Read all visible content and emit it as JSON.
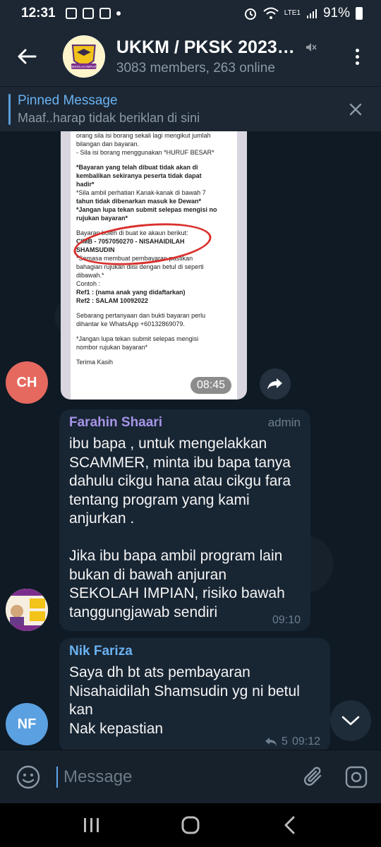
{
  "status_bar": {
    "time": "12:31",
    "battery": "91%",
    "network": "LTE1"
  },
  "header": {
    "title": "UKKM / PKSK 2023 -…",
    "subtitle": "3083 members, 263 online",
    "avatar_text": "SEKOLAH IMPIAN"
  },
  "pinned": {
    "title": "Pinned Message",
    "message": "Maaf..harap tidak beriklan di sini"
  },
  "photo_message": {
    "time": "08:45",
    "sender_initials": "CH",
    "lines": [
      {
        "t": "orang sila isi borang sekali lagi mengikut jumlah",
        "b": false
      },
      {
        "t": "bilangan dan bayaran.",
        "b": false
      },
      {
        "t": "- Sila isi borang menggunakan *HURUF BESAR*",
        "b": false
      },
      {
        "t": "",
        "b": false
      },
      {
        "t": "*Bayaran yang telah dibuat tidak akan di",
        "b": true
      },
      {
        "t": "kembalikan sekiranya peserta tidak dapat",
        "b": true
      },
      {
        "t": "hadir*",
        "b": true
      },
      {
        "t": "*Sila ambil perhatian Kanak-kanak di bawah 7",
        "b": false
      },
      {
        "t": "tahun tidak dibenarkan masuk ke Dewan*",
        "b": true
      },
      {
        "t": "*Jangan lupa tekan submit selepas mengisi no",
        "b": true
      },
      {
        "t": "rujukan bayaran*",
        "b": true
      },
      {
        "t": "",
        "b": false
      },
      {
        "t": "Bayaran boleh di buat ke akaun berikut:",
        "b": false
      },
      {
        "t": "CIMB - 7057050270 - NISAHAIDILAH",
        "b": true
      },
      {
        "t": "SHAMSUDIN",
        "b": true
      },
      {
        "t": "*Semasa membuat pembayaran pastikan",
        "b": false
      },
      {
        "t": "bahagian rujukan diisi dengan betul di seperti",
        "b": false
      },
      {
        "t": "dibawah.*",
        "b": false
      },
      {
        "t": "Contoh :",
        "b": false
      },
      {
        "t": "Ref1 : (nama anak yang didaftarkan)",
        "b": true
      },
      {
        "t": "Ref2 : SALAM 10092022",
        "b": true
      },
      {
        "t": "",
        "b": false
      },
      {
        "t": "Sebarang pertanyaan dan bukti bayaran perlu",
        "b": false
      },
      {
        "t": "dihantar ke WhatsApp +60132869079.",
        "b": false
      },
      {
        "t": "",
        "b": false
      },
      {
        "t": "*Jangan lupa tekan submit selepas mengisi",
        "b": false
      },
      {
        "t": "nombor rujukan bayaran*",
        "b": false
      },
      {
        "t": "",
        "b": false
      },
      {
        "t": "Terima Kasih",
        "b": false
      }
    ]
  },
  "messages": [
    {
      "sender": "Farahin Shaari",
      "sender_color": "#a695e7",
      "badge": "admin",
      "text": "ibu bapa , untuk mengelakkan SCAMMER, minta ibu bapa tanya dahulu cikgu hana atau cikgu fara tentang program yang kami anjurkan .\n\nJika ibu bapa ambil program lain bukan di bawah anjuran SEKOLAH IMPIAN, risiko bawah tanggungjawab sendiri",
      "time": "09:10"
    },
    {
      "sender": "Nik Fariza",
      "sender_color": "#6ab2f2",
      "sender_initials": "NF",
      "text": "Saya dh bt ats pembayaran Nisahaidilah Shamsudin yg ni betul kan\nNak kepastian",
      "replies": "5",
      "time": "09:12"
    }
  ],
  "input": {
    "placeholder": "Message"
  },
  "colors": {
    "bg": "#0e1621",
    "bubble": "#182533",
    "accent": "#6ab2f2",
    "header": "#1c2733"
  }
}
